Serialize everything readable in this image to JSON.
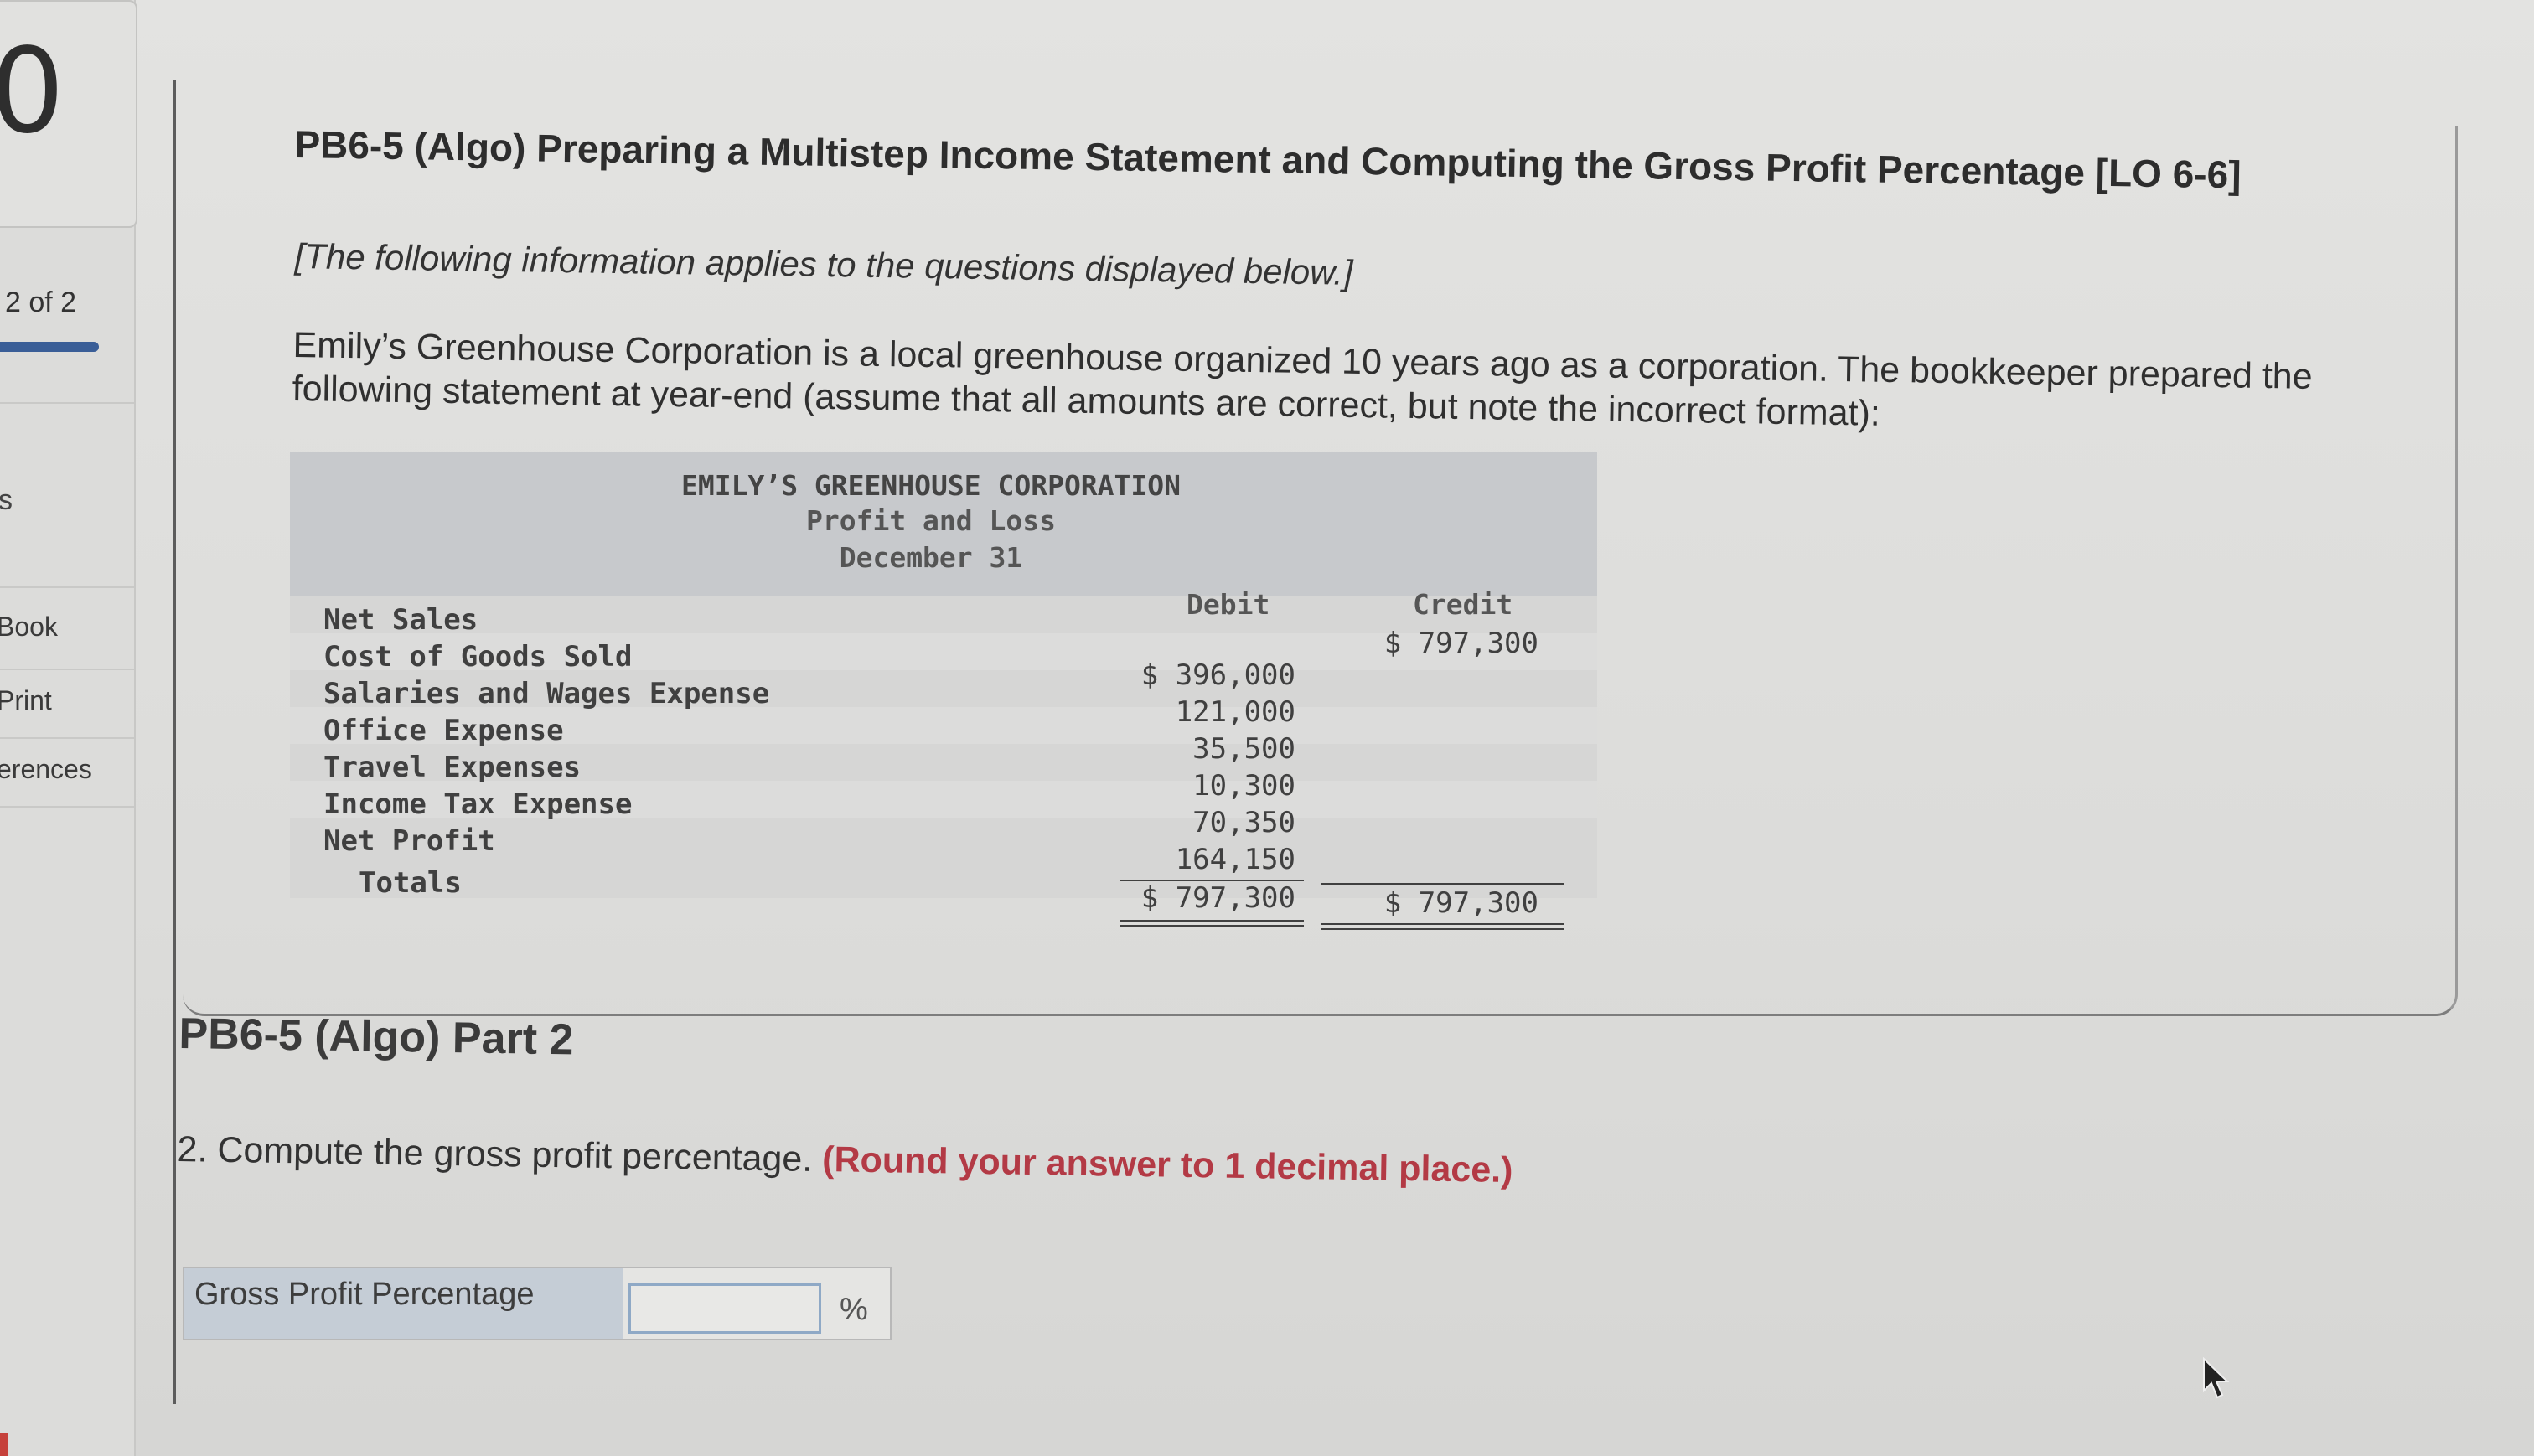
{
  "sidebar": {
    "score": "0",
    "progress_label": "2 of 2",
    "progress_fraction": 1.0,
    "fragment": "s",
    "items": [
      {
        "label": "Book"
      },
      {
        "label": "Print"
      },
      {
        "label": "erences"
      }
    ]
  },
  "problem": {
    "title": "PB6-5 (Algo) Preparing a Multistep Income Statement and Computing the Gross Profit Percentage [LO 6-6]",
    "intro": "[The following information applies to the questions displayed below.]",
    "description": "Emily’s Greenhouse Corporation is a local greenhouse organized 10 years ago as a corporation. The bookkeeper prepared the following statement at year-end (assume that all amounts are correct, but note the incorrect format):"
  },
  "statement": {
    "company": "EMILY’S GREENHOUSE CORPORATION",
    "subtitle": "Profit and Loss",
    "date": "December 31",
    "debit_header": "Debit",
    "credit_header": "Credit",
    "rows": [
      {
        "label": "Net Sales",
        "debit": "",
        "credit": "$ 797,300"
      },
      {
        "label": "Cost of Goods Sold",
        "debit": "$ 396,000",
        "credit": ""
      },
      {
        "label": "Salaries and Wages Expense",
        "debit": "121,000",
        "credit": ""
      },
      {
        "label": "Office Expense",
        "debit": "35,500",
        "credit": ""
      },
      {
        "label": "Travel Expenses",
        "debit": "10,300",
        "credit": ""
      },
      {
        "label": "Income Tax Expense",
        "debit": "70,350",
        "credit": ""
      },
      {
        "label": "Net Profit",
        "debit": "164,150",
        "credit": ""
      }
    ],
    "totals": {
      "label": "Totals",
      "debit": "$ 797,300",
      "credit": "$ 797,300"
    }
  },
  "part2": {
    "title": "PB6-5 (Algo) Part 2",
    "question_number": "2.",
    "question": "Compute the gross profit percentage.",
    "hint": "(Round your answer to 1 decimal place.)",
    "answer_label": "Gross Profit Percentage",
    "answer_value": "",
    "answer_unit": "%"
  },
  "colors": {
    "progress": "#3a5e97",
    "hint": "#b33a45",
    "header_bg": "#c7c9cc",
    "answer_label_bg": "#c5cdd6"
  },
  "icons": {
    "cursor": "mouse-pointer-icon"
  }
}
